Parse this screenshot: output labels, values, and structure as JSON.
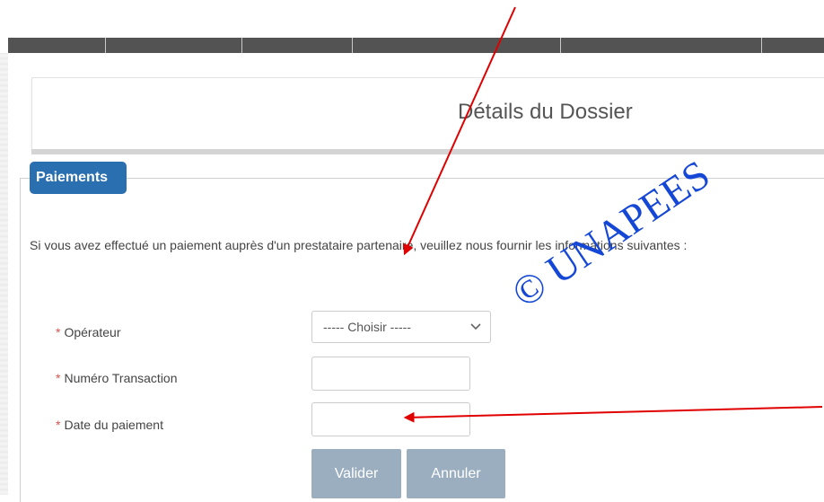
{
  "page": {
    "title": "Détails du Dossier"
  },
  "payments": {
    "legend": "Paiements",
    "intro": "Si vous avez effectué un paiement auprès d'un prestataire partenaire, veuillez nous fournir les informations suivantes :",
    "required_marker": "*",
    "operator_label": "Opérateur",
    "operator_selected": "----- Choisir -----",
    "transaction_label": "Numéro Transaction",
    "transaction_value": "",
    "date_label": "Date du paiement",
    "date_value": "",
    "submit_label": "Valider",
    "cancel_label": "Annuler"
  },
  "watermark": {
    "text": "© UNAPEES",
    "color": "#1447d6"
  },
  "colors": {
    "navbar": "#535353",
    "legend_bg": "#2a6fb0",
    "button_bg": "#9aaec0",
    "annotation_arrow": "#e00000",
    "required": "#d9534f"
  }
}
